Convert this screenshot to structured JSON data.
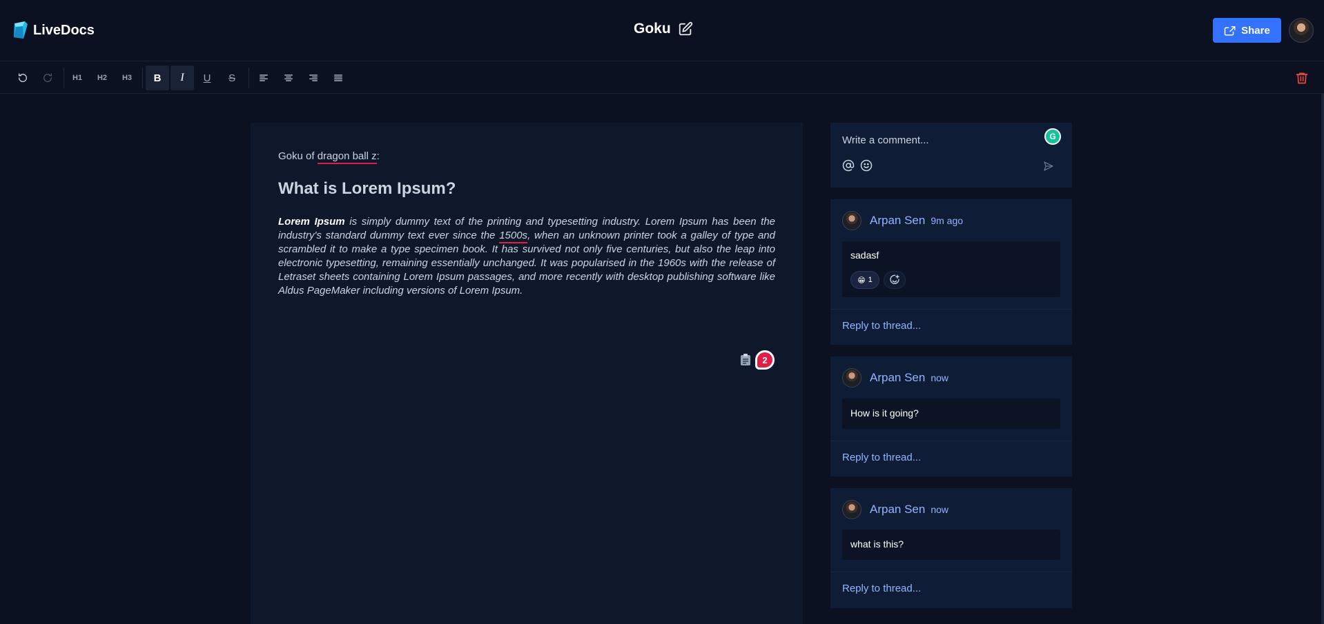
{
  "header": {
    "app_name": "LiveDocs",
    "doc_title": "Goku",
    "share_label": "Share"
  },
  "toolbar": {
    "undo": "undo-icon",
    "redo": "redo-icon",
    "h1": "H1",
    "h2": "H2",
    "h3": "H3",
    "bold": "B",
    "italic": "I",
    "underline": "U",
    "strike": "S"
  },
  "editor": {
    "line1_prefix": "Goku of ",
    "line1_link": "dragon ball z",
    "line1_suffix": ":",
    "heading": "What is Lorem Ipsum?",
    "para_bold": "Lorem Ipsum",
    "para_part1": " is simply dummy text of the printing and typesetting industry. Lorem Ipsum has been the industry's standard dummy text ever since the ",
    "para_link": "1500s",
    "para_part2": ", when an unknown printer took a galley of type and scrambled it to make a type specimen book. It has survived not only five centuries, but also the leap into electronic typesetting, remaining essentially unchanged. It was popularised in the 1960s with the release of Letraset sheets containing Lorem Ipsum passages, and more recently with desktop publishing software like Aldus PageMaker including versions of Lorem Ipsum.",
    "comment_count": "2"
  },
  "composer": {
    "placeholder": "Write a comment...",
    "grammarly": "G"
  },
  "threads": [
    {
      "author": "Arpan Sen",
      "time": "9m ago",
      "text": "sadasf",
      "reaction_emoji": "😁",
      "reaction_count": "1",
      "reply_placeholder": "Reply to thread..."
    },
    {
      "author": "Arpan Sen",
      "time": "now",
      "text": "How is it going?",
      "reply_placeholder": "Reply to thread..."
    },
    {
      "author": "Arpan Sen",
      "time": "now",
      "text": "what is this?",
      "reply_placeholder": "Reply to thread..."
    }
  ],
  "colors": {
    "background": "#0b1120",
    "panel": "#0f172a",
    "thread": "#0f1c36",
    "accent": "#3371ff",
    "danger": "#e11d48",
    "link": "#93b4ff"
  }
}
